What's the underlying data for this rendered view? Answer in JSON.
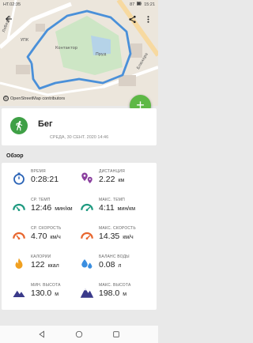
{
  "status_bar": {
    "left_text": "HT.02:35",
    "battery": "87",
    "time": "15:21"
  },
  "map": {
    "labels": {
      "street_top": "Лебедев",
      "street_left": "УПК",
      "contactor": "Контактор",
      "pond": "Пруд",
      "street_right": "Блюхера"
    },
    "credit": "OpenStreetMap contributors",
    "route_color": "#4a90d9"
  },
  "toolbar": {
    "back_icon": "arrow-back-icon",
    "share_icon": "share-icon",
    "more_icon": "more-vert-icon"
  },
  "fab": {
    "label": "+",
    "color": "#5db845"
  },
  "activity": {
    "title": "Бег",
    "date": "СРЕДА, 30 СЕНТ. 2020 14:46",
    "icon": "running-icon",
    "color": "#3fa046"
  },
  "overview": {
    "heading": "Обзор",
    "stats": [
      {
        "label": "ВРЕМЯ",
        "value": "0:28:21",
        "unit": "",
        "icon": "stopwatch-icon",
        "color": "#2a63b6"
      },
      {
        "label": "ДИСТАНЦИЯ",
        "value": "2.22",
        "unit": "км",
        "icon": "distance-pins-icon",
        "color": "#8a3f9e"
      },
      {
        "label": "СР. ТЕМП",
        "value": "12:46",
        "unit": "мин/км",
        "icon": "pace-gauge-icon",
        "color": "#1e9a80"
      },
      {
        "label": "МАКС. ТЕМП",
        "value": "4:11",
        "unit": "мин/км",
        "icon": "max-pace-gauge-icon",
        "color": "#1e9a80"
      },
      {
        "label": "СР. СКОРОСТЬ",
        "value": "4.70",
        "unit": "км/ч",
        "icon": "speed-gauge-icon",
        "color": "#e8662e"
      },
      {
        "label": "МАКС. СКОРОСТЬ",
        "value": "14.35",
        "unit": "км/ч",
        "icon": "max-speed-gauge-icon",
        "color": "#e8662e"
      },
      {
        "label": "КАЛОРИИ",
        "value": "122",
        "unit": "ккал",
        "icon": "flame-icon",
        "color": "#f0a020"
      },
      {
        "label": "БАЛАНС ВОДЫ",
        "value": "0.08",
        "unit": "л",
        "icon": "water-drops-icon",
        "color": "#3a8ee0"
      },
      {
        "label": "МИН. ВЫСОТА",
        "value": "130.0",
        "unit": "м",
        "icon": "min-mountain-icon",
        "color": "#3a3a8a"
      },
      {
        "label": "МАКС. ВЫСОТА",
        "value": "198.0",
        "unit": "м",
        "icon": "max-mountain-icon",
        "color": "#3a3a8a"
      }
    ]
  },
  "navbar": {
    "back": "nav-back-icon",
    "home": "nav-home-icon",
    "recents": "nav-recents-icon"
  }
}
